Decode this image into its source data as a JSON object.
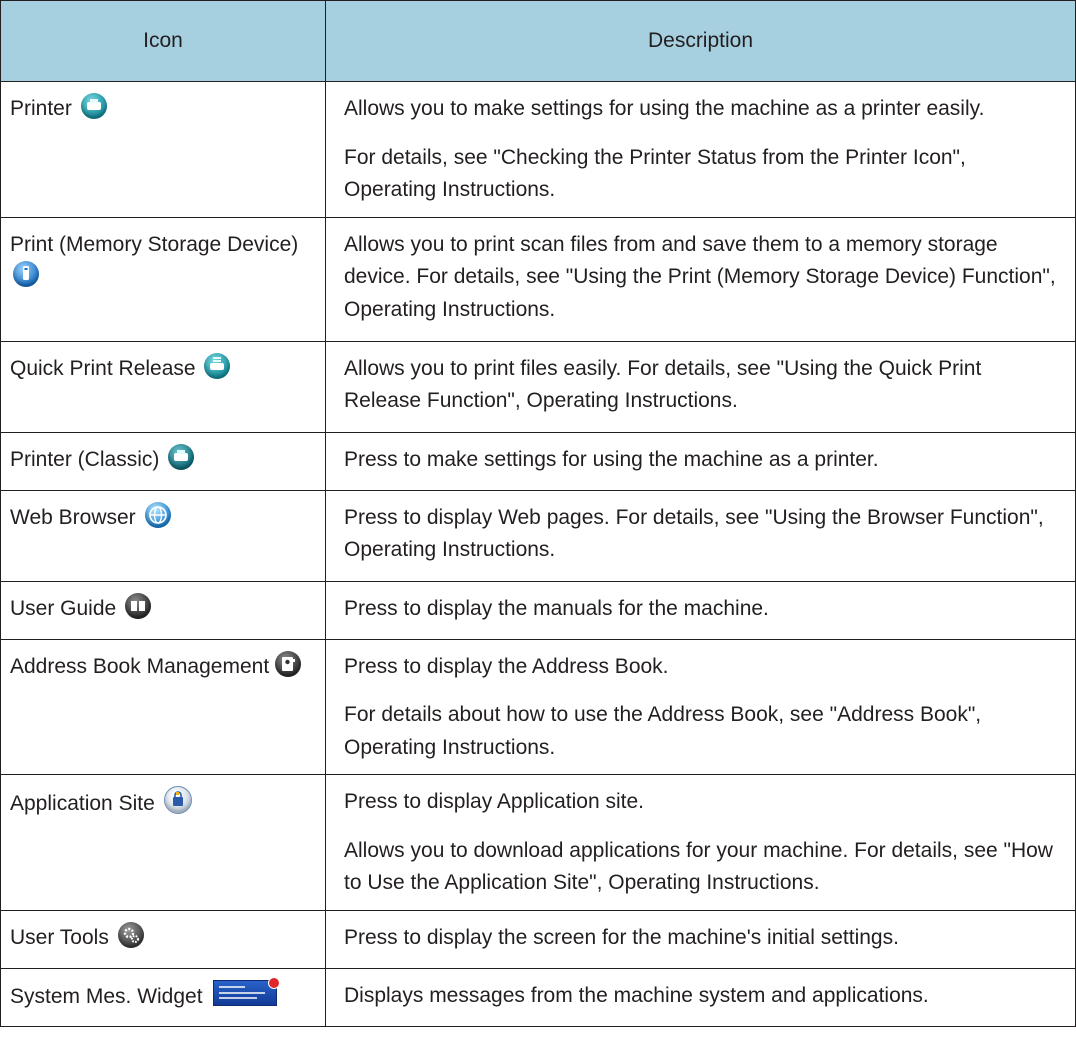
{
  "table": {
    "headers": {
      "icon": "Icon",
      "description": "Description"
    },
    "rows": [
      {
        "name": "Printer",
        "icon": "printer-icon",
        "desc": [
          "Allows you to make settings for using the machine as a printer easily.",
          "For details, see \"Checking the Printer Status from the Printer Icon\", Operating Instructions."
        ]
      },
      {
        "name": "Print (Memory Storage Device)",
        "icon": "memory-storage-icon",
        "desc": [
          "Allows you to print scan files from and save them to a memory storage device. For details, see \"Using the Print (Memory Storage Device) Function\", Operating Instructions."
        ]
      },
      {
        "name": "Quick Print Release",
        "icon": "quick-print-release-icon",
        "desc": [
          "Allows you to print files easily. For details, see \"Using the Quick Print Release Function\", Operating Instructions."
        ]
      },
      {
        "name": "Printer (Classic)",
        "icon": "printer-classic-icon",
        "desc": [
          "Press to make settings for using the machine as a printer."
        ]
      },
      {
        "name": "Web Browser",
        "icon": "globe-icon",
        "desc": [
          "Press to display Web pages. For details, see \"Using the Browser Function\", Operating Instructions."
        ]
      },
      {
        "name": "User Guide",
        "icon": "book-icon",
        "desc": [
          "Press to display the manuals for the machine."
        ]
      },
      {
        "name": "Address Book Management",
        "icon": "address-book-icon",
        "desc": [
          "Press to display the Address Book.",
          "For details about how to use the Address Book, see \"Address Book\", Operating Instructions."
        ]
      },
      {
        "name": "Application Site",
        "icon": "application-site-icon",
        "desc": [
          "Press to display Application site.",
          "Allows you to download applications for your machine. For details, see \"How to Use the Application Site\", Operating Instructions."
        ]
      },
      {
        "name": "User Tools",
        "icon": "gear-icon",
        "desc": [
          "Press to display the screen for the machine's initial settings."
        ]
      },
      {
        "name": "System Mes. Widget",
        "icon": "system-message-widget-icon",
        "desc": [
          "Displays messages from the machine system and applications."
        ]
      }
    ]
  },
  "colors": {
    "header_bg": "#a6cfe0",
    "border": "#231f20",
    "text": "#231f20"
  }
}
